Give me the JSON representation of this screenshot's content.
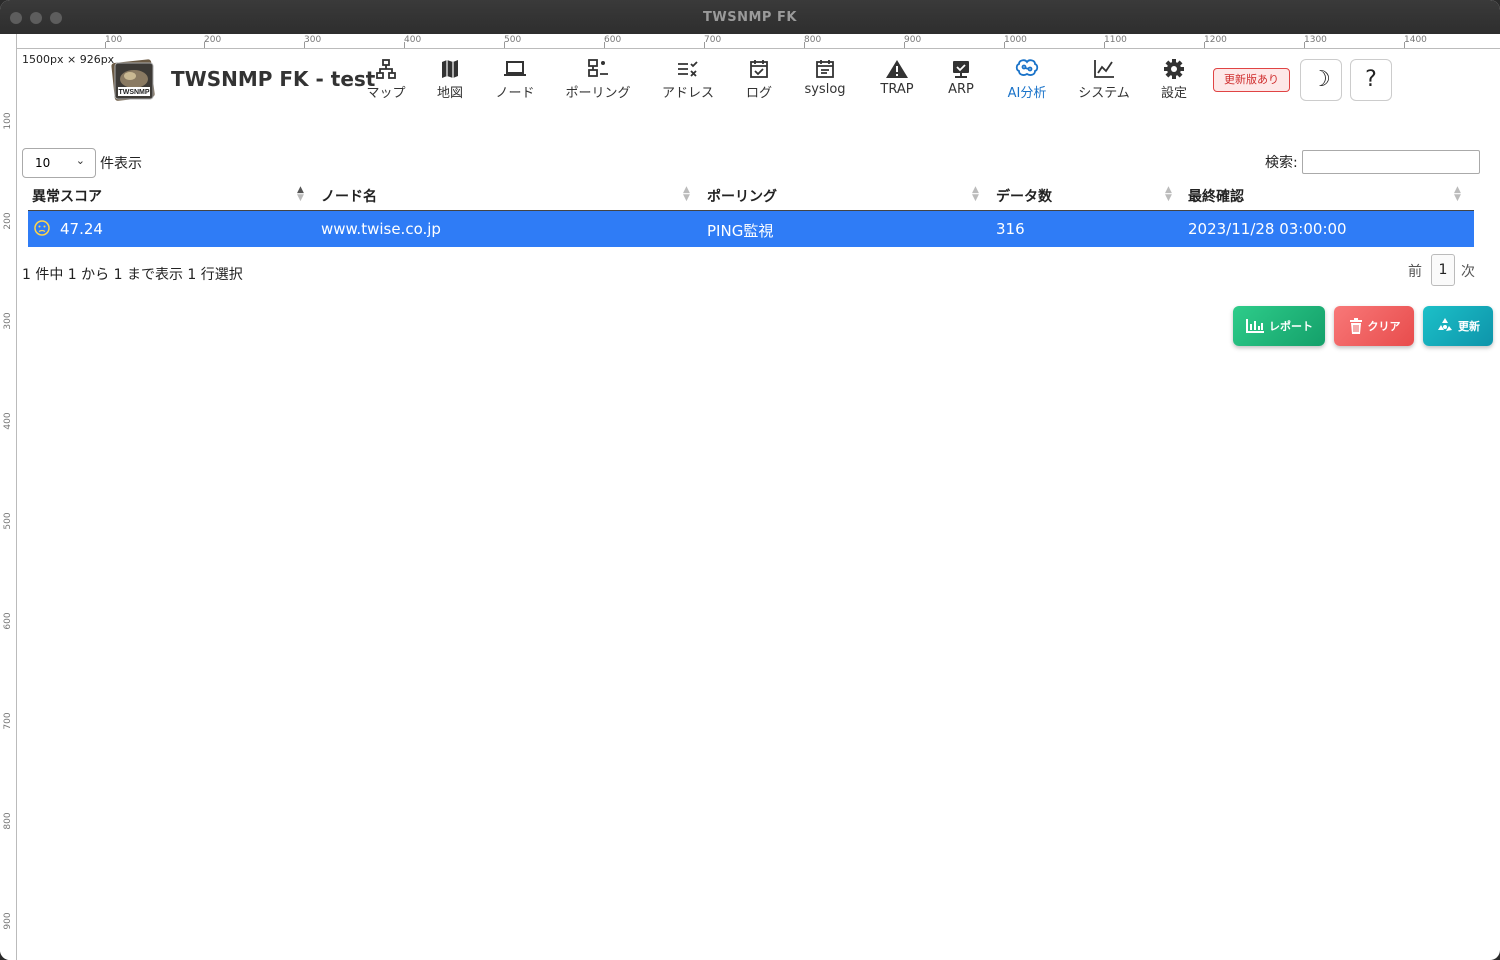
{
  "window": {
    "title": "TWSNMP FK"
  },
  "ruler": {
    "top": [
      "100",
      "200",
      "300",
      "400",
      "500",
      "600",
      "700",
      "800",
      "900",
      "1000",
      "1100",
      "1200",
      "1300",
      "1400"
    ],
    "left": [
      "100",
      "200",
      "300",
      "400",
      "500",
      "600",
      "700",
      "800",
      "900"
    ],
    "dimensions": "1500px × 926px"
  },
  "app": {
    "title": "TWSNMP FK - test",
    "logo_text": "TWSNMP"
  },
  "nav": {
    "items": [
      {
        "label": "マップ",
        "icon": "network-icon"
      },
      {
        "label": "地図",
        "icon": "map-icon"
      },
      {
        "label": "ノード",
        "icon": "laptop-icon"
      },
      {
        "label": "ポーリング",
        "icon": "polling-icon"
      },
      {
        "label": "アドレス",
        "icon": "checklist-icon"
      },
      {
        "label": "ログ",
        "icon": "calendar-check-icon"
      },
      {
        "label": "syslog",
        "icon": "calendar-list-icon"
      },
      {
        "label": "TRAP",
        "icon": "warning-icon"
      },
      {
        "label": "ARP",
        "icon": "monitor-icon"
      },
      {
        "label": "AI分析",
        "icon": "brain-icon",
        "active": true
      },
      {
        "label": "システム",
        "icon": "line-chart-icon"
      },
      {
        "label": "設定",
        "icon": "gear-icon"
      }
    ],
    "update_badge": "更新版あり",
    "theme_button": "☽",
    "help_button": "?"
  },
  "table_controls": {
    "page_length": "10",
    "page_length_label": "件表示",
    "search_label": "検索:",
    "search_value": ""
  },
  "table": {
    "columns": [
      "異常スコア",
      "ノード名",
      "ポーリング",
      "データ数",
      "最終確認"
    ],
    "rows": [
      {
        "score": "47.24",
        "node": "www.twise.co.jp",
        "polling": "PING監視",
        "count": "316",
        "last": "2023/11/28 03:00:00",
        "selected": true
      }
    ]
  },
  "footer": {
    "info": "1 件中 1 から 1 まで表示 1 行選択",
    "prev": "前",
    "page": "1",
    "next": "次"
  },
  "actions": {
    "report": "レポート",
    "clear": "クリア",
    "refresh": "更新"
  },
  "colors": {
    "accent": "#1a73c9",
    "selected_row": "#2f7cf6",
    "report_btn": "#1db97a",
    "clear_btn": "#f06262",
    "refresh_btn": "#13a8b8"
  }
}
